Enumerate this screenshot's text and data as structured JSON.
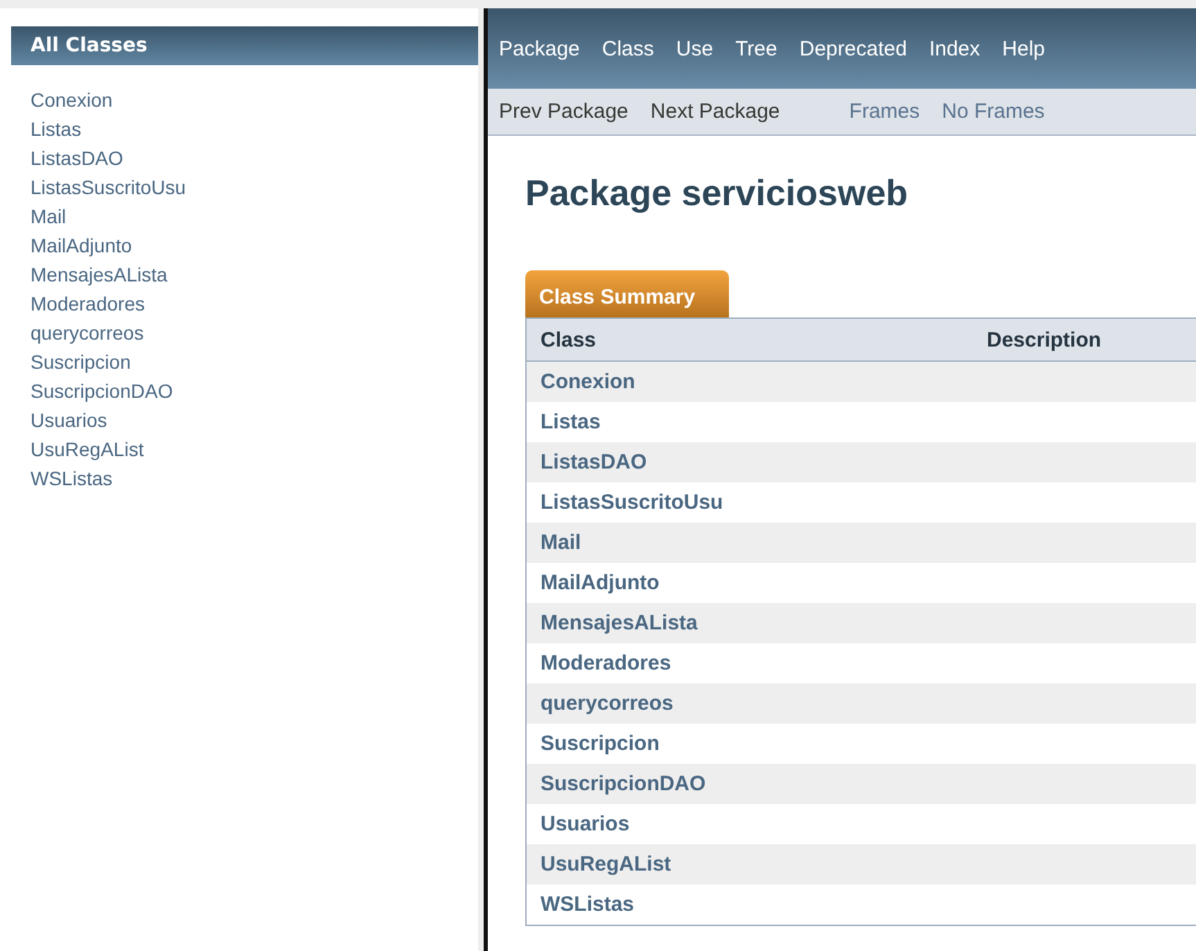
{
  "all_classes": {
    "title": "All Classes",
    "items": [
      "Conexion",
      "Listas",
      "ListasDAO",
      "ListasSuscritoUsu",
      "Mail",
      "MailAdjunto",
      "MensajesALista",
      "Moderadores",
      "querycorreos",
      "Suscripcion",
      "SuscripcionDAO",
      "Usuarios",
      "UsuRegAList",
      "WSListas"
    ]
  },
  "nav_bar": {
    "items": [
      "Package",
      "Class",
      "Use",
      "Tree",
      "Deprecated",
      "Index",
      "Help"
    ]
  },
  "sub_nav": {
    "left": [
      "Prev Package",
      "Next Package"
    ],
    "right": [
      "Frames",
      "No Frames"
    ]
  },
  "package_title": "Package serviciosweb",
  "summary": {
    "tab": "Class Summary",
    "columns": [
      "Class",
      "Description"
    ],
    "rows": [
      "Conexion",
      "Listas",
      "ListasDAO",
      "ListasSuscritoUsu",
      "Mail",
      "MailAdjunto",
      "MensajesALista",
      "Moderadores",
      "querycorreos",
      "Suscripcion",
      "SuscripcionDAO",
      "Usuarios",
      "UsuRegAList",
      "WSListas"
    ]
  }
}
